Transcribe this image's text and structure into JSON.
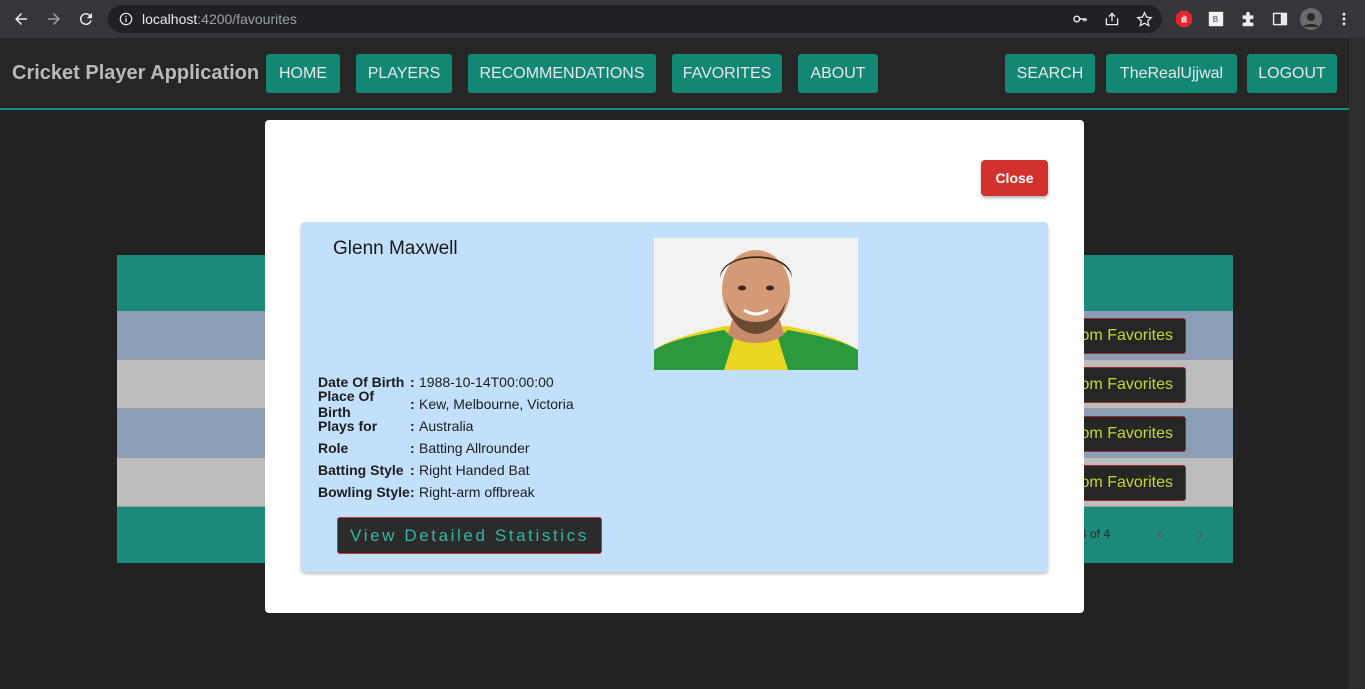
{
  "browser": {
    "url_host": "localhost",
    "url_path": ":4200/favourites"
  },
  "app": {
    "brand": "Cricket Player Application",
    "nav": {
      "home": "HOME",
      "players": "PLAYERS",
      "recommendations": "RECOMMENDATIONS",
      "favorites": "FAVORITES",
      "about": "ABOUT",
      "search": "SEARCH",
      "user": "TheRealUjjwal",
      "logout": "LOGOUT"
    }
  },
  "table": {
    "rows": [
      {
        "button": "om Favorites"
      },
      {
        "button": "om Favorites"
      },
      {
        "button": "om Favorites"
      },
      {
        "button": "om Favorites"
      }
    ],
    "pager": "4 of 4"
  },
  "modal": {
    "close_label": "Close",
    "player": {
      "name": "Glenn Maxwell",
      "details": [
        {
          "label": "Date Of Birth",
          "colon": ":",
          "value": "1988-10-14T00:00:00"
        },
        {
          "label": "Place Of Birth",
          "colon": ":",
          "value": "Kew, Melbourne, Victoria"
        },
        {
          "label": "Plays for",
          "colon": ":",
          "value": "Australia"
        },
        {
          "label": "Role",
          "colon": ":",
          "value": "Batting Allrounder"
        },
        {
          "label": "Batting Style",
          "colon": ":",
          "value": "Right Handed Bat"
        },
        {
          "label": "Bowling Style",
          "colon": ":",
          "value": "Right-arm offbreak"
        }
      ],
      "stats_button": "View Detailed Statistics"
    }
  },
  "colors": {
    "teal": "#128774",
    "close_red": "#d2322b",
    "card_blue": "#c2dffc"
  }
}
